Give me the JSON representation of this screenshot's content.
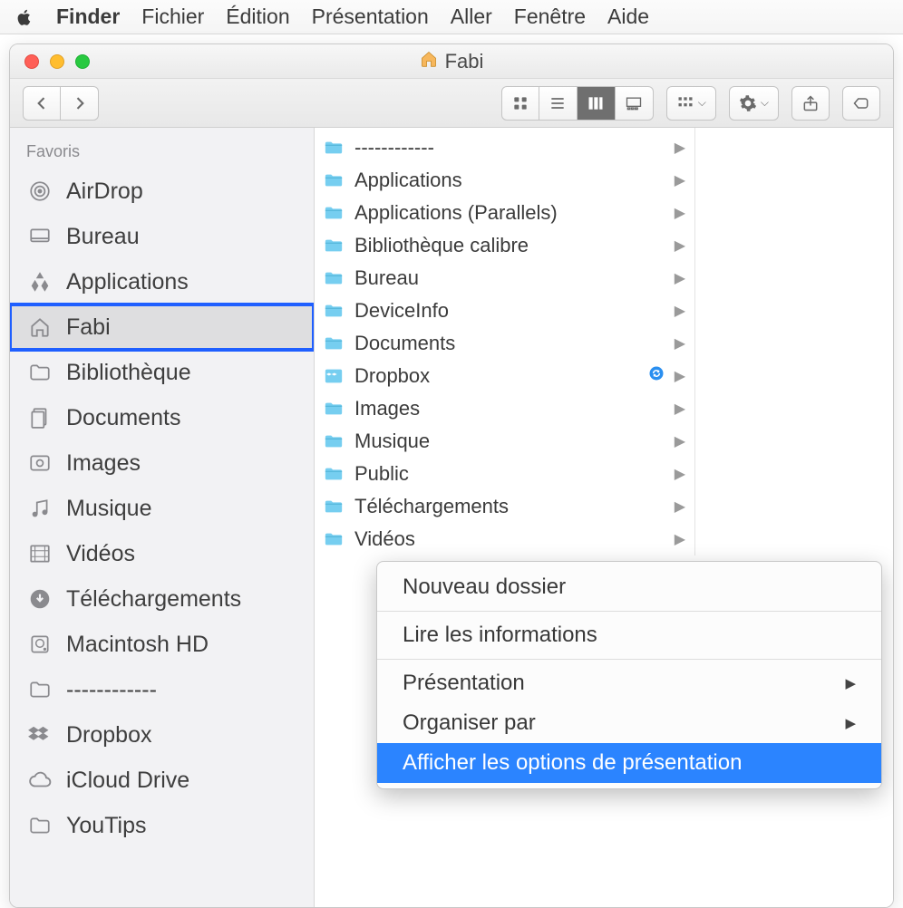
{
  "menubar": {
    "app": "Finder",
    "items": [
      "Fichier",
      "Édition",
      "Présentation",
      "Aller",
      "Fenêtre",
      "Aide"
    ]
  },
  "window": {
    "title": "Fabi"
  },
  "sidebar": {
    "section": "Favoris",
    "items": [
      {
        "icon": "airdrop",
        "label": "AirDrop"
      },
      {
        "icon": "desktop",
        "label": "Bureau"
      },
      {
        "icon": "apps",
        "label": "Applications"
      },
      {
        "icon": "home",
        "label": "Fabi",
        "selected": true
      },
      {
        "icon": "folder",
        "label": "Bibliothèque"
      },
      {
        "icon": "documents",
        "label": "Documents"
      },
      {
        "icon": "images",
        "label": "Images"
      },
      {
        "icon": "music",
        "label": "Musique"
      },
      {
        "icon": "video",
        "label": "Vidéos"
      },
      {
        "icon": "download",
        "label": "Téléchargements"
      },
      {
        "icon": "hdd",
        "label": "Macintosh HD"
      },
      {
        "icon": "folder",
        "label": "------------"
      },
      {
        "icon": "dropbox",
        "label": "Dropbox"
      },
      {
        "icon": "cloud",
        "label": "iCloud Drive"
      },
      {
        "icon": "folder",
        "label": "YouTips"
      }
    ]
  },
  "column": {
    "rows": [
      {
        "type": "folder",
        "label": "------------"
      },
      {
        "type": "folder",
        "label": "Applications"
      },
      {
        "type": "parallels",
        "label": "Applications (Parallels)"
      },
      {
        "type": "folder",
        "label": "Bibliothèque calibre"
      },
      {
        "type": "folder",
        "label": "Bureau"
      },
      {
        "type": "folder",
        "label": "DeviceInfo"
      },
      {
        "type": "folder",
        "label": "Documents"
      },
      {
        "type": "dropbox",
        "label": "Dropbox",
        "sync": true
      },
      {
        "type": "images",
        "label": "Images"
      },
      {
        "type": "music",
        "label": "Musique"
      },
      {
        "type": "public",
        "label": "Public"
      },
      {
        "type": "download",
        "label": "Téléchargements"
      },
      {
        "type": "video",
        "label": "Vidéos"
      }
    ]
  },
  "context_menu": {
    "groups": [
      [
        {
          "label": "Nouveau dossier"
        }
      ],
      [
        {
          "label": "Lire les informations"
        }
      ],
      [
        {
          "label": "Présentation",
          "submenu": true
        },
        {
          "label": "Organiser par",
          "submenu": true
        },
        {
          "label": "Afficher les options de présentation",
          "highlight": true
        }
      ]
    ]
  }
}
